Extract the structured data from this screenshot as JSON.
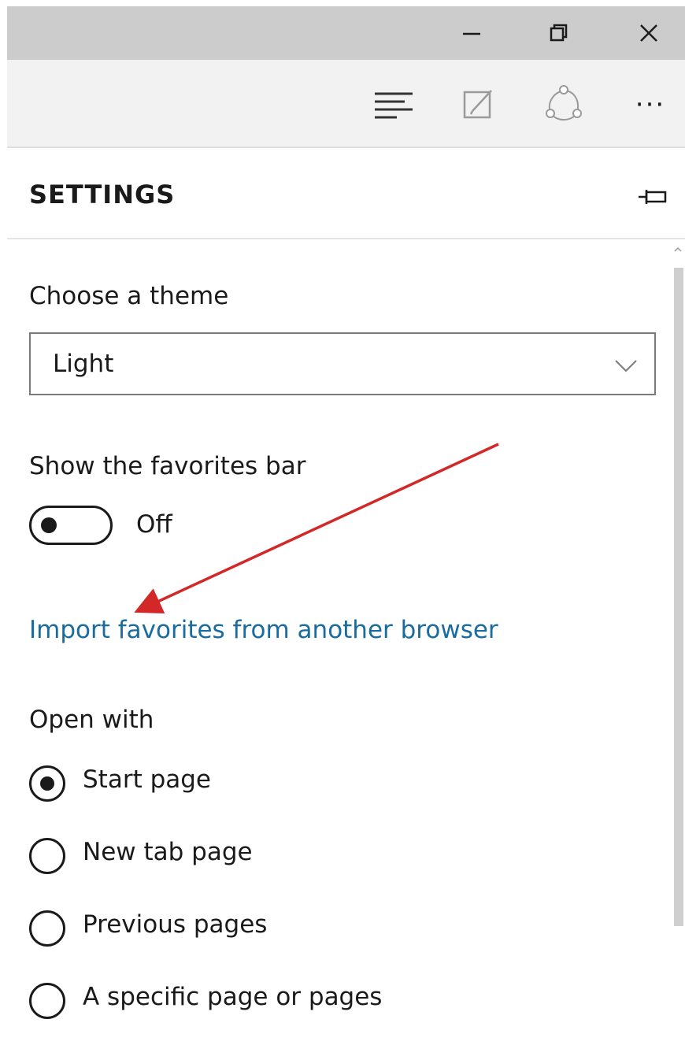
{
  "window": {
    "minimize_icon": "minimize-icon",
    "restore_icon": "restore-icon",
    "close_icon": "close-icon"
  },
  "toolbar": {
    "hub_icon": "hub-icon",
    "note_icon": "web-note-icon",
    "share_icon": "share-icon",
    "more_label": "···"
  },
  "panel": {
    "title": "SETTINGS",
    "pin_icon": "pin-icon"
  },
  "settings": {
    "theme_label": "Choose a theme",
    "theme_value": "Light",
    "favorites_bar_label": "Show the favorites bar",
    "favorites_bar_state": "Off",
    "import_link": "Import favorites from another browser",
    "open_with_label": "Open with",
    "open_with_options": [
      {
        "label": "Start page",
        "checked": true
      },
      {
        "label": "New tab page",
        "checked": false
      },
      {
        "label": "Previous pages",
        "checked": false
      },
      {
        "label": "A specific page or pages",
        "checked": false
      }
    ]
  },
  "colors": {
    "titlebar": "#cccccc",
    "toolbar": "#f2f2f2",
    "link": "#1b6c9e",
    "arrow": "#d22828"
  }
}
